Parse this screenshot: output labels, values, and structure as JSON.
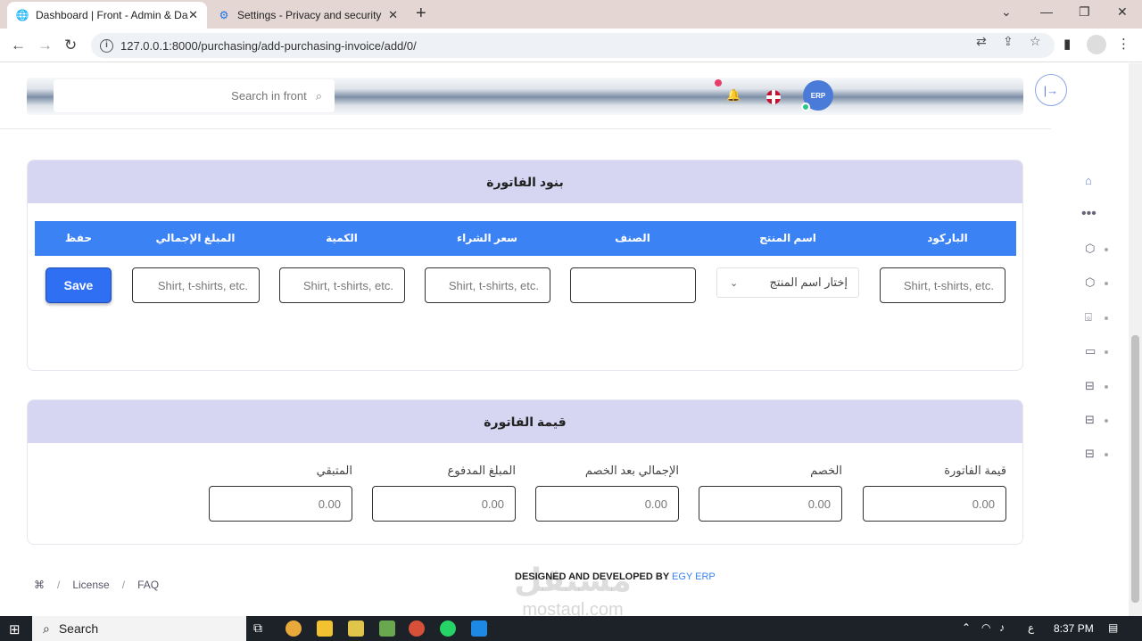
{
  "browser": {
    "tabs": [
      {
        "title": "Dashboard | Front - Admin & Da",
        "icon": "globe-icon"
      },
      {
        "title": "Settings - Privacy and security",
        "icon": "gear-icon"
      }
    ],
    "url": "127.0.0.1:8000/purchasing/add-purchasing-invoice/add/0/"
  },
  "header": {
    "search_placeholder": "Search in front",
    "logo_text": "ERP"
  },
  "invoice_items": {
    "title": "بنود الفاتورة",
    "columns": [
      "الباركود",
      "اسم المنتج",
      "الصنف",
      "سعر الشراء",
      "الكمية",
      "المبلغ الإجمالي",
      "حفظ"
    ],
    "barcode_placeholder": "Shirt, t-shirts, etc.",
    "product_select": "إختار اسم المنتج",
    "price_placeholder": "Shirt, t-shirts, etc.",
    "qty_placeholder": "Shirt, t-shirts, etc.",
    "total_placeholder": "Shirt, t-shirts, etc.",
    "save_label": "Save"
  },
  "invoice_value": {
    "title": "قيمة الفاتورة",
    "fields": [
      {
        "label": "قيمة الفاتورة",
        "placeholder": "0.00"
      },
      {
        "label": "الخصم",
        "placeholder": "0.00"
      },
      {
        "label": "الإجمالي بعد الخصم",
        "placeholder": "0.00"
      },
      {
        "label": "المبلغ المدفوع",
        "placeholder": "0.00"
      },
      {
        "label": "المتبقي",
        "placeholder": "0.00"
      }
    ]
  },
  "footer": {
    "license": "License",
    "faq": "FAQ",
    "credit": "DESIGNED AND DEVELOPED BY",
    "brand": "EGY ERP",
    "watermark": "مستقل",
    "watermark_sub": "mostaql.com"
  },
  "taskbar": {
    "search_label": "Search",
    "time": "8:37 PM",
    "lang": "ع"
  }
}
